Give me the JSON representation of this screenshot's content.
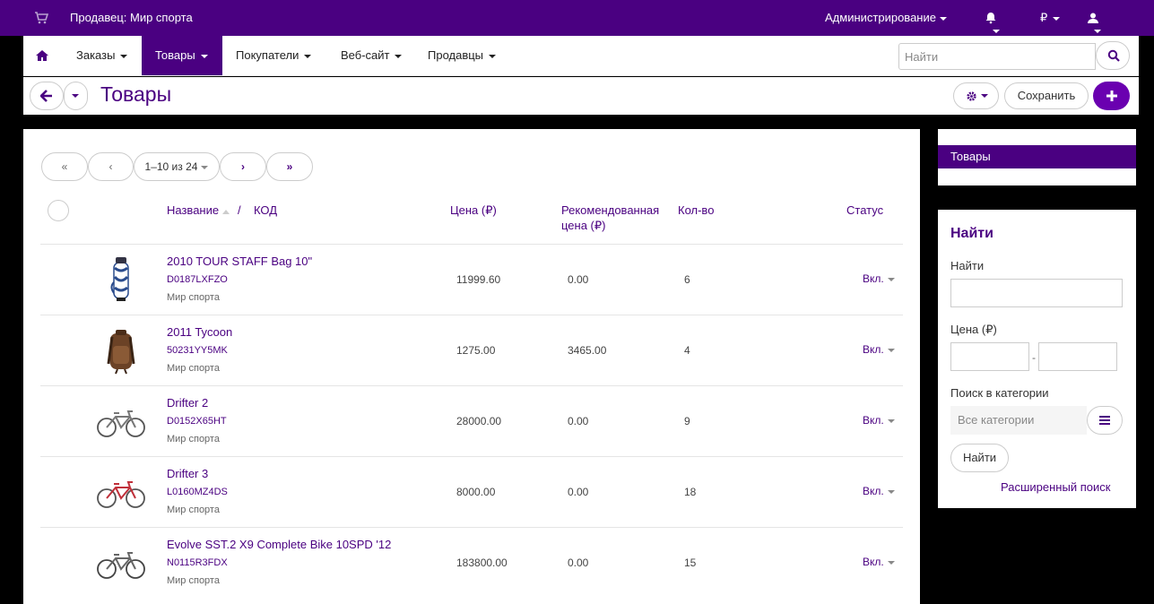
{
  "topbar": {
    "vendor_label": "Продавец: Мир спорта",
    "admin_label": "Администрирование",
    "currency_label": "₽"
  },
  "nav": {
    "items": [
      {
        "label": "Заказы"
      },
      {
        "label": "Товары"
      },
      {
        "label": "Покупатели"
      },
      {
        "label": "Веб-сайт"
      },
      {
        "label": "Продавцы"
      }
    ],
    "search_placeholder": "Найти"
  },
  "titlebar": {
    "title": "Товары",
    "save_label": "Сохранить"
  },
  "pager": {
    "first": "«",
    "prev": "‹",
    "range": "1–10 из 24",
    "next": "›",
    "last": "»"
  },
  "table": {
    "headers": {
      "name": "Название",
      "separator": "/",
      "code": "КОД",
      "price": "Цена (₽)",
      "rec_price_line1": "Рекомендованная",
      "rec_price_line2": "цена (₽)",
      "qty": "Кол-во",
      "status": "Статус"
    },
    "rows": [
      {
        "name": "2010 TOUR STAFF Bag 10\"",
        "code": "D0187LXFZO",
        "vendor": "Мир спорта",
        "price": "11999.60",
        "rec_price": "0.00",
        "qty": "6",
        "status": "Вкл.",
        "icon": "golf-bag"
      },
      {
        "name": "2011 Tycoon",
        "code": "50231YY5MK",
        "vendor": "Мир спорта",
        "price": "1275.00",
        "rec_price": "3465.00",
        "qty": "4",
        "status": "Вкл.",
        "icon": "backpack"
      },
      {
        "name": "Drifter 2",
        "code": "D0152X65HT",
        "vendor": "Мир спорта",
        "price": "28000.00",
        "rec_price": "0.00",
        "qty": "9",
        "status": "Вкл.",
        "icon": "bicycle"
      },
      {
        "name": "Drifter 3",
        "code": "L0160MZ4DS",
        "vendor": "Мир спорта",
        "price": "8000.00",
        "rec_price": "0.00",
        "qty": "18",
        "status": "Вкл.",
        "icon": "bicycle"
      },
      {
        "name": "Evolve SST.2 X9 Complete Bike 10SPD '12",
        "code": "N0115R3FDX",
        "vendor": "Мир спорта",
        "price": "183800.00",
        "rec_price": "0.00",
        "qty": "15",
        "status": "Вкл.",
        "icon": "bicycle"
      }
    ]
  },
  "sidebar": {
    "menu_item": "Товары",
    "search_title": "Найти",
    "find_label": "Найти",
    "price_label": "Цена (₽)",
    "price_separator": "-",
    "category_label": "Поиск в категории",
    "category_placeholder": "Все категории",
    "find_button": "Найти",
    "advanced_link": "Расширенный поиск"
  },
  "colors": {
    "brand": "#4a0081",
    "accent": "#6a00b0"
  }
}
